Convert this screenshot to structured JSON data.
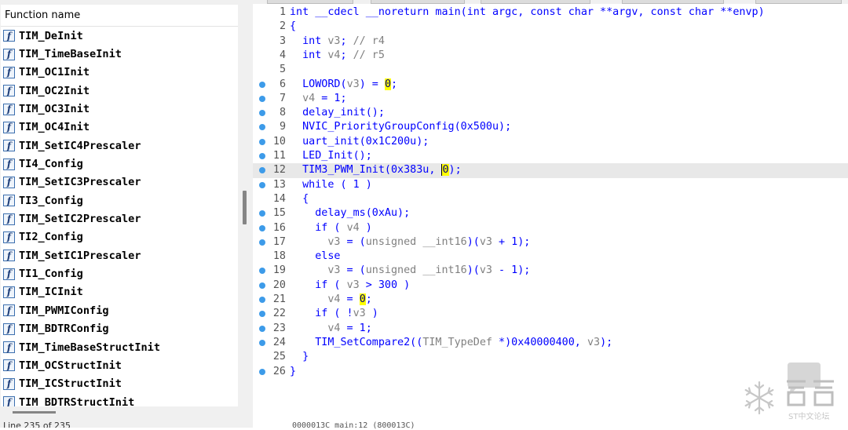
{
  "function_list": {
    "header": "Function name",
    "items": [
      "TIM_DeInit",
      "TIM_TimeBaseInit",
      "TIM_OC1Init",
      "TIM_OC2Init",
      "TIM_OC3Init",
      "TIM_OC4Init",
      "TIM_SetIC4Prescaler",
      "TI4_Config",
      "TIM_SetIC3Prescaler",
      "TI3_Config",
      "TIM_SetIC2Prescaler",
      "TI2_Config",
      "TIM_SetIC1Prescaler",
      "TI1_Config",
      "TIM_ICInit",
      "TIM_PWMIConfig",
      "TIM_BDTRConfig",
      "TIM_TimeBaseStructInit",
      "TIM_OCStructInit",
      "TIM_ICStructInit",
      "TIM_BDTRStructInit"
    ],
    "icon": "function-icon",
    "status": "Line 235 of 235"
  },
  "editor": {
    "current_line": 12,
    "lines": [
      {
        "n": "1",
        "dot": false,
        "html": "int __cdecl __noreturn main(int argc, const char **argv, const char **envp)"
      },
      {
        "n": "2",
        "dot": false,
        "html": "{"
      },
      {
        "n": "3",
        "dot": false,
        "html": "  int v3; // r4"
      },
      {
        "n": "4",
        "dot": false,
        "html": "  int v4; // r5"
      },
      {
        "n": "5",
        "dot": false,
        "html": ""
      },
      {
        "n": "6",
        "dot": true,
        "html": "  LOWORD(v3) = 0;"
      },
      {
        "n": "7",
        "dot": true,
        "html": "  v4 = 1;"
      },
      {
        "n": "8",
        "dot": true,
        "html": "  delay_init();"
      },
      {
        "n": "9",
        "dot": true,
        "html": "  NVIC_PriorityGroupConfig(0x500u);"
      },
      {
        "n": "10",
        "dot": true,
        "html": "  uart_init(0x1C200u);"
      },
      {
        "n": "11",
        "dot": true,
        "html": "  LED_Init();"
      },
      {
        "n": "12",
        "dot": true,
        "html": "  TIM3_PWM_Init(0x383u, 0);"
      },
      {
        "n": "13",
        "dot": true,
        "html": "  while ( 1 )"
      },
      {
        "n": "14",
        "dot": false,
        "html": "  {"
      },
      {
        "n": "15",
        "dot": true,
        "html": "    delay_ms(0xAu);"
      },
      {
        "n": "16",
        "dot": true,
        "html": "    if ( v4 )"
      },
      {
        "n": "17",
        "dot": true,
        "html": "      v3 = (unsigned __int16)(v3 + 1);"
      },
      {
        "n": "18",
        "dot": false,
        "html": "    else"
      },
      {
        "n": "19",
        "dot": true,
        "html": "      v3 = (unsigned __int16)(v3 - 1);"
      },
      {
        "n": "20",
        "dot": true,
        "html": "    if ( v3 > 300 )"
      },
      {
        "n": "21",
        "dot": true,
        "html": "      v4 = 0;"
      },
      {
        "n": "22",
        "dot": true,
        "html": "    if ( !v3 )"
      },
      {
        "n": "23",
        "dot": true,
        "html": "      v4 = 1;"
      },
      {
        "n": "24",
        "dot": true,
        "html": "    TIM_SetCompare2((TIM_TypeDef *)0x40000400, v3);"
      },
      {
        "n": "25",
        "dot": false,
        "html": "  }"
      },
      {
        "n": "26",
        "dot": true,
        "html": "}"
      }
    ],
    "status": "0000013C main:12 (800013C)"
  },
  "watermark": {
    "icon": "snowflake-icon",
    "text": "ST中文论坛"
  },
  "colors": {
    "keyword": "#0000ff",
    "variable": "#808080",
    "highlight": "#ffff00",
    "breakpoint_dot": "#3d9be9",
    "current_line": "#e8e8e8"
  }
}
